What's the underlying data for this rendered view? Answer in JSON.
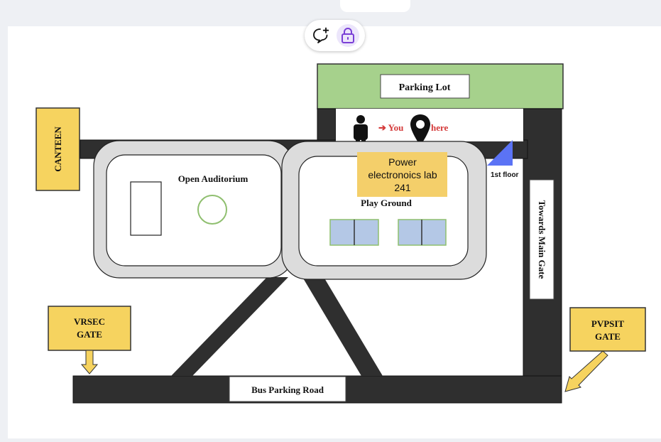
{
  "toolbar": {
    "comment_icon": "comment-add-icon",
    "lock_icon": "lock-icon",
    "lock_accent": "#7a3fd6"
  },
  "map": {
    "parking_lot": "Parking Lot",
    "you_are_here_prefix": "➔ You",
    "you_are_here_suffix": "here",
    "canteen": "CANTEEN",
    "open_auditorium": "Open Auditorium",
    "play_ground": "Play Ground",
    "towards_main_gate": "Towards Main Gate",
    "vrsec_gate_line1": "VRSEC",
    "vrsec_gate_line2": "GATE",
    "pvpsit_gate_line1": "PVPSIT",
    "pvpsit_gate_line2": "GATE",
    "bus_parking_road": "Bus Parking Road",
    "floor_label": "1st floor",
    "sticky_note_line1": "Power",
    "sticky_note_line2": "electronoics lab",
    "sticky_note_line3": "241",
    "colors": {
      "parking_green": "#a6d18c",
      "sticky_yellow": "#f4cf6a",
      "floor_triangle": "#5b73f5",
      "highlight_red": "#ee2b2b",
      "playground_court": "#b4c8e6"
    }
  }
}
